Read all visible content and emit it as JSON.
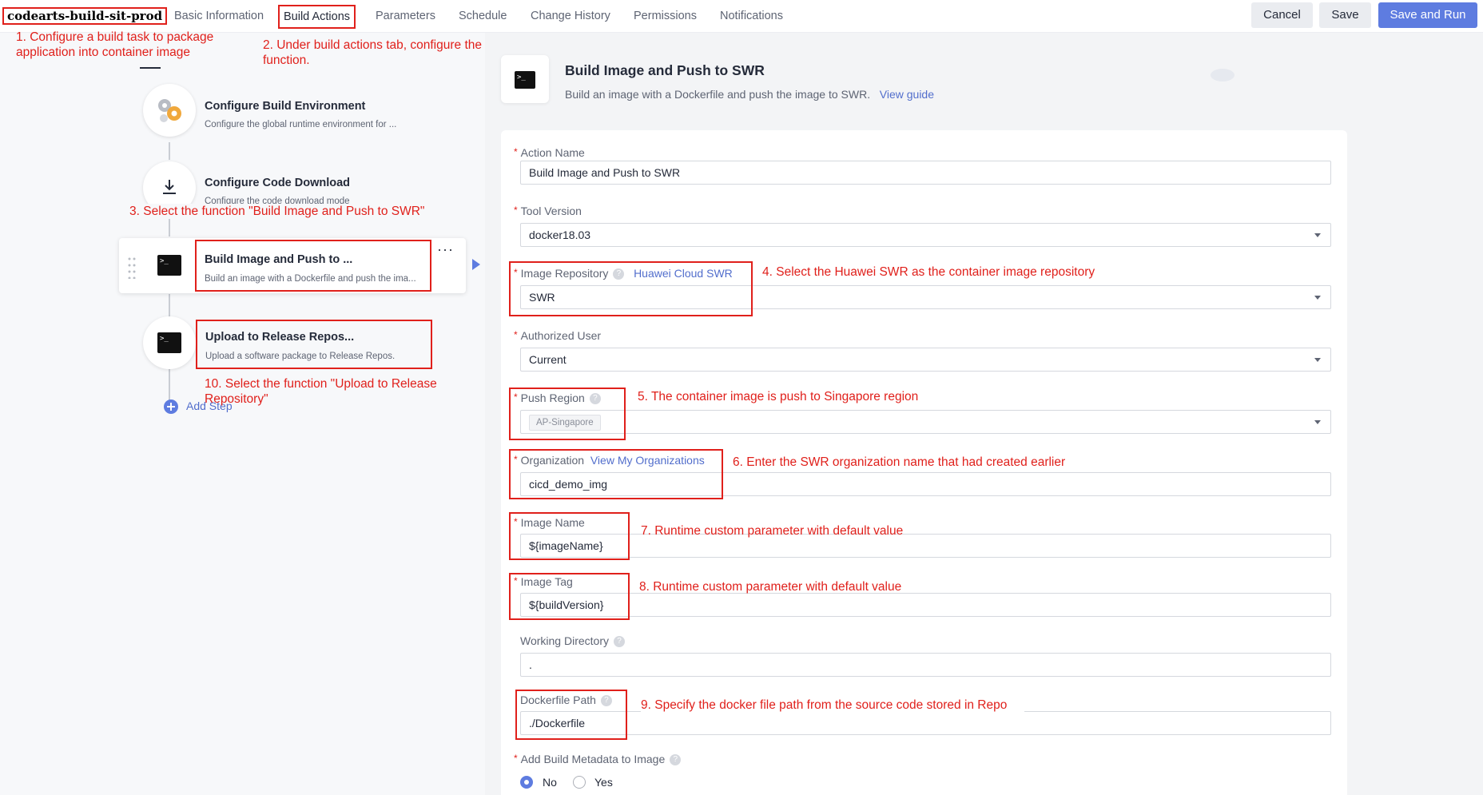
{
  "header": {
    "project_title": "codearts-build-sit-prod",
    "tabs": [
      "Basic Information",
      "Build Actions",
      "Parameters",
      "Schedule",
      "Change History",
      "Permissions",
      "Notifications"
    ],
    "buttons": {
      "cancel": "Cancel",
      "save": "Save",
      "save_and_run": "Save and Run"
    }
  },
  "steps": [
    {
      "title": "Configure Build Environment",
      "desc": "Configure the global runtime environment for ..."
    },
    {
      "title": "Configure Code Download",
      "desc": "Configure the code download mode"
    },
    {
      "title": "Build Image and Push to ...",
      "desc": "Build an image with a Dockerfile and push the ima..."
    },
    {
      "title": "Upload to Release Repos...",
      "desc": "Upload a software package to Release Repos."
    }
  ],
  "add_step": "Add Step",
  "action": {
    "title": "Build Image and Push to SWR",
    "desc": "Build an image with a Dockerfile and push the image to SWR.",
    "guide_link": "View guide"
  },
  "form": {
    "action_name": {
      "label": "Action Name",
      "value": "Build Image and Push to SWR"
    },
    "tool_version": {
      "label": "Tool Version",
      "value": "docker18.03"
    },
    "image_repository": {
      "label": "Image Repository",
      "link": "Huawei Cloud SWR",
      "value": "SWR"
    },
    "authorized_user": {
      "label": "Authorized User",
      "value": "Current"
    },
    "push_region": {
      "label": "Push Region",
      "value": "AP-Singapore"
    },
    "organization": {
      "label": "Organization",
      "link": "View My Organizations",
      "value": "cicd_demo_img"
    },
    "image_name": {
      "label": "Image Name",
      "value": "${imageName}"
    },
    "image_tag": {
      "label": "Image Tag",
      "value": "${buildVersion}"
    },
    "working_directory": {
      "label": "Working Directory",
      "value": "."
    },
    "dockerfile_path": {
      "label": "Dockerfile Path",
      "value": "./Dockerfile"
    },
    "add_metadata": {
      "label": "Add Build Metadata to Image",
      "options": [
        "No",
        "Yes"
      ],
      "selected": "No"
    }
  },
  "annotations": {
    "a1": "1. Configure a build task to package application into container image",
    "a2": "2. Under build actions tab, configure the function.",
    "a3": "3. Select the function \"Build Image and Push to SWR\"",
    "a4": "4. Select the Huawei SWR as the container image repository",
    "a5": "5. The container image is push to Singapore region",
    "a6": "6. Enter the SWR organization name that had created earlier",
    "a7": "7. Runtime custom parameter with default value",
    "a8": "8. Runtime custom parameter with default value",
    "a9": "9. Specify the docker file path from the source code stored in Repo",
    "a10": "10. Select the function \"Upload to Release Repository\""
  },
  "colors": {
    "accent": "#5e7ce0",
    "annotation_red": "#e0201b",
    "link": "#526ecc"
  },
  "icons": [
    "gear-cluster-icon",
    "download-icon",
    "terminal-icon",
    "drag-handle-icon",
    "more-icon",
    "arrow-right-icon",
    "add-circle-icon",
    "help-icon",
    "dropdown-caret-icon"
  ]
}
